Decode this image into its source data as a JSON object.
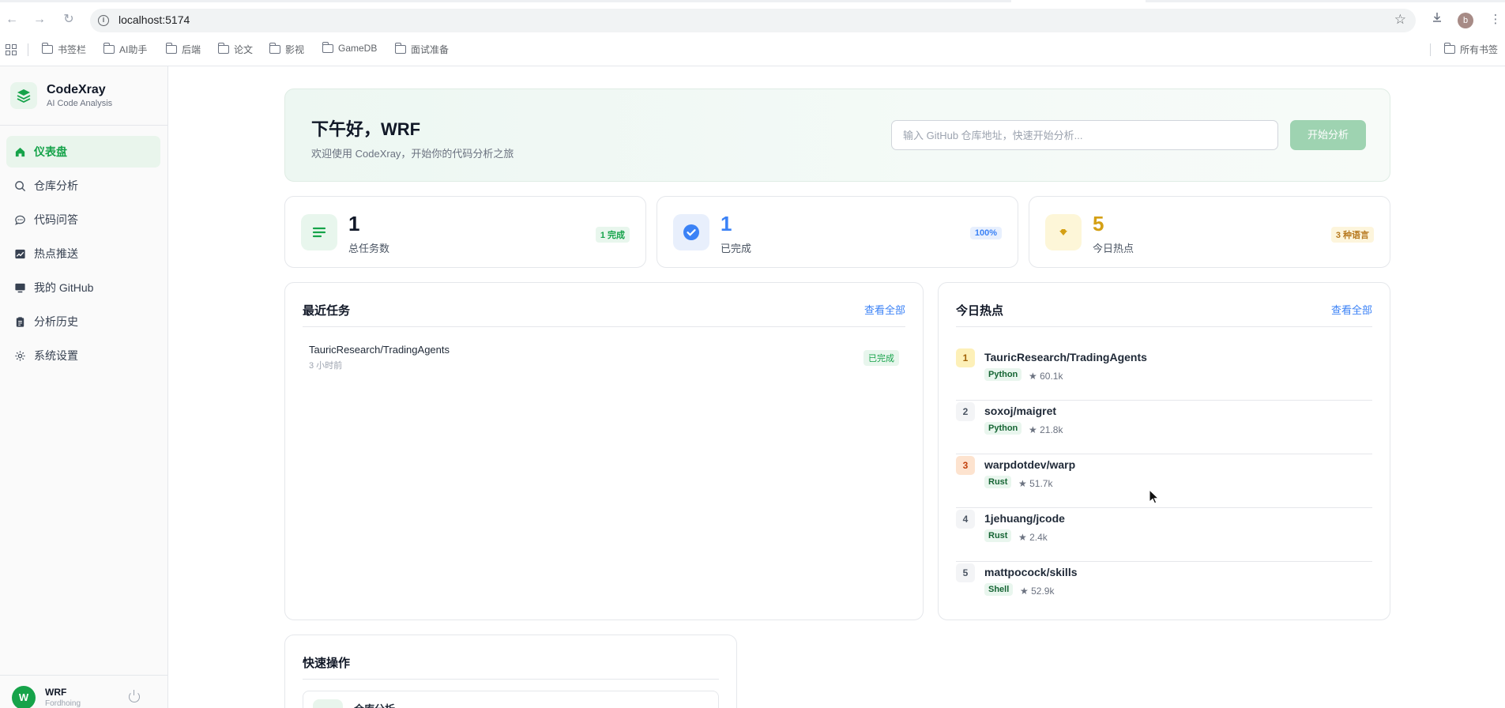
{
  "browser": {
    "url": "localhost:5174",
    "profile_initial": "b",
    "bookmarks": [
      "书签栏",
      "AI助手",
      "后端",
      "论文",
      "影视",
      "GameDB",
      "面试准备"
    ],
    "all_bookmarks": "所有书签"
  },
  "sidebar": {
    "brand_name": "CodeXray",
    "brand_sub": "AI Code Analysis",
    "items": [
      {
        "label": "仪表盘",
        "icon": "home-icon"
      },
      {
        "label": "仓库分析",
        "icon": "search-icon"
      },
      {
        "label": "代码问答",
        "icon": "chat-icon"
      },
      {
        "label": "热点推送",
        "icon": "trend-chart-icon"
      },
      {
        "label": "我的 GitHub",
        "icon": "monitor-icon"
      },
      {
        "label": "分析历史",
        "icon": "clipboard-icon"
      },
      {
        "label": "系统设置",
        "icon": "gear-icon"
      }
    ],
    "user": {
      "initial": "W",
      "name": "WRF",
      "status": "Fordhoing"
    }
  },
  "hero": {
    "greeting": "下午好，WRF",
    "subtitle": "欢迎使用 CodeXray，开始你的代码分析之旅",
    "input_placeholder": "输入 GitHub 仓库地址，快速开始分析...",
    "button": "开始分析"
  },
  "stats": [
    {
      "value": "1",
      "label": "总任务数",
      "badge": "1 完成",
      "color": "#111827",
      "badge_color": "#16a34a",
      "badge_bg": "#e8f6ed",
      "icon": "list-icon"
    },
    {
      "value": "1",
      "label": "已完成",
      "badge": "100%",
      "color": "#3b82f6",
      "badge_color": "#3b82f6",
      "badge_bg": "#e8f0fe",
      "icon": "check-circle-icon"
    },
    {
      "value": "5",
      "label": "今日热点",
      "badge": "3 种语言",
      "color": "#d4a015",
      "badge_color": "#b7791f",
      "badge_bg": "#fdf5dc",
      "icon": "fire-icon"
    }
  ],
  "recent": {
    "title": "最近任务",
    "link": "查看全部",
    "tasks": [
      {
        "name": "TauricResearch/TradingAgents",
        "time": "3 小时前",
        "status": "已完成"
      }
    ]
  },
  "hot": {
    "title": "今日热点",
    "link": "查看全部",
    "items": [
      {
        "rank": "1",
        "name": "TauricResearch/TradingAgents",
        "lang": "Python",
        "stars": "60.1k"
      },
      {
        "rank": "2",
        "name": "soxoj/maigret",
        "lang": "Python",
        "stars": "21.8k"
      },
      {
        "rank": "3",
        "name": "warpdotdev/warp",
        "lang": "Rust",
        "stars": "51.7k"
      },
      {
        "rank": "4",
        "name": "1jehuang/jcode",
        "lang": "Rust",
        "stars": "2.4k"
      },
      {
        "rank": "5",
        "name": "mattpocock/skills",
        "lang": "Shell",
        "stars": "52.9k"
      }
    ]
  },
  "quick": {
    "title": "快速操作",
    "first_label": "仓库分析"
  }
}
